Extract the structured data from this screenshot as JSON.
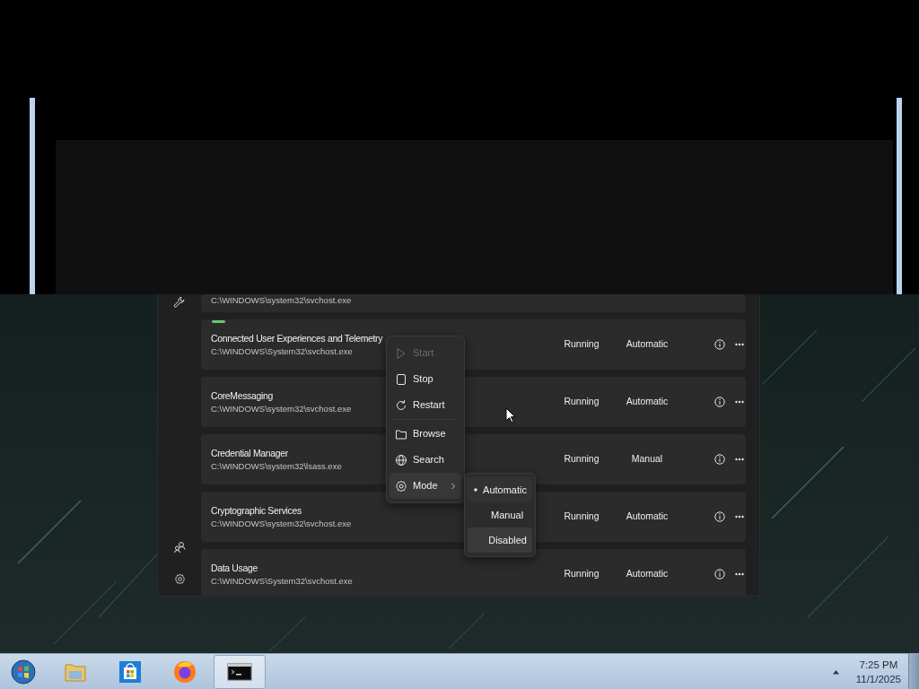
{
  "clipped_row": {
    "path": "C:\\WINDOWS\\system32\\svchost.exe"
  },
  "services": [
    {
      "name": "Connected User Experiences and Telemetry",
      "path": "C:\\WINDOWS\\System32\\svchost.exe",
      "status": "Running",
      "mode": "Automatic",
      "busy": true
    },
    {
      "name": "CoreMessaging",
      "path": "C:\\WINDOWS\\system32\\svchost.exe",
      "status": "Running",
      "mode": "Automatic",
      "busy": false
    },
    {
      "name": "Credential Manager",
      "path": "C:\\WINDOWS\\system32\\lsass.exe",
      "status": "Running",
      "mode": "Manual",
      "busy": false
    },
    {
      "name": "Cryptographic Services",
      "path": "C:\\WINDOWS\\system32\\svchost.exe",
      "status": "Running",
      "mode": "Automatic",
      "busy": false
    },
    {
      "name": "Data Usage",
      "path": "C:\\WINDOWS\\System32\\svchost.exe",
      "status": "Running",
      "mode": "Automatic",
      "busy": false
    }
  ],
  "context_menu": {
    "items": [
      {
        "kind": "start",
        "label": "Start",
        "disabled": true,
        "hovered": false,
        "separator_before": false
      },
      {
        "kind": "stop",
        "label": "Stop",
        "disabled": false,
        "hovered": false,
        "separator_before": false
      },
      {
        "kind": "restart",
        "label": "Restart",
        "disabled": false,
        "hovered": false,
        "separator_before": false
      },
      {
        "kind": "browse",
        "label": "Browse",
        "disabled": false,
        "hovered": false,
        "separator_before": true
      },
      {
        "kind": "search",
        "label": "Search",
        "disabled": false,
        "hovered": false,
        "separator_before": false
      },
      {
        "kind": "mode",
        "label": "Mode",
        "disabled": false,
        "hovered": true,
        "separator_before": false
      }
    ]
  },
  "mode_submenu": {
    "items": [
      {
        "label": "Automatic",
        "selected": true,
        "hovered": false
      },
      {
        "label": "Manual",
        "selected": false,
        "hovered": false
      },
      {
        "label": "Disabled",
        "selected": false,
        "hovered": true
      }
    ]
  },
  "taskbar": {
    "apps": [
      {
        "kind": "start",
        "active": false
      },
      {
        "kind": "folder",
        "active": false
      },
      {
        "kind": "store",
        "active": false
      },
      {
        "kind": "browser",
        "active": false
      },
      {
        "kind": "terminal",
        "active": true
      }
    ],
    "clock_time": "7:25 PM",
    "clock_date": "11/1/2025"
  }
}
